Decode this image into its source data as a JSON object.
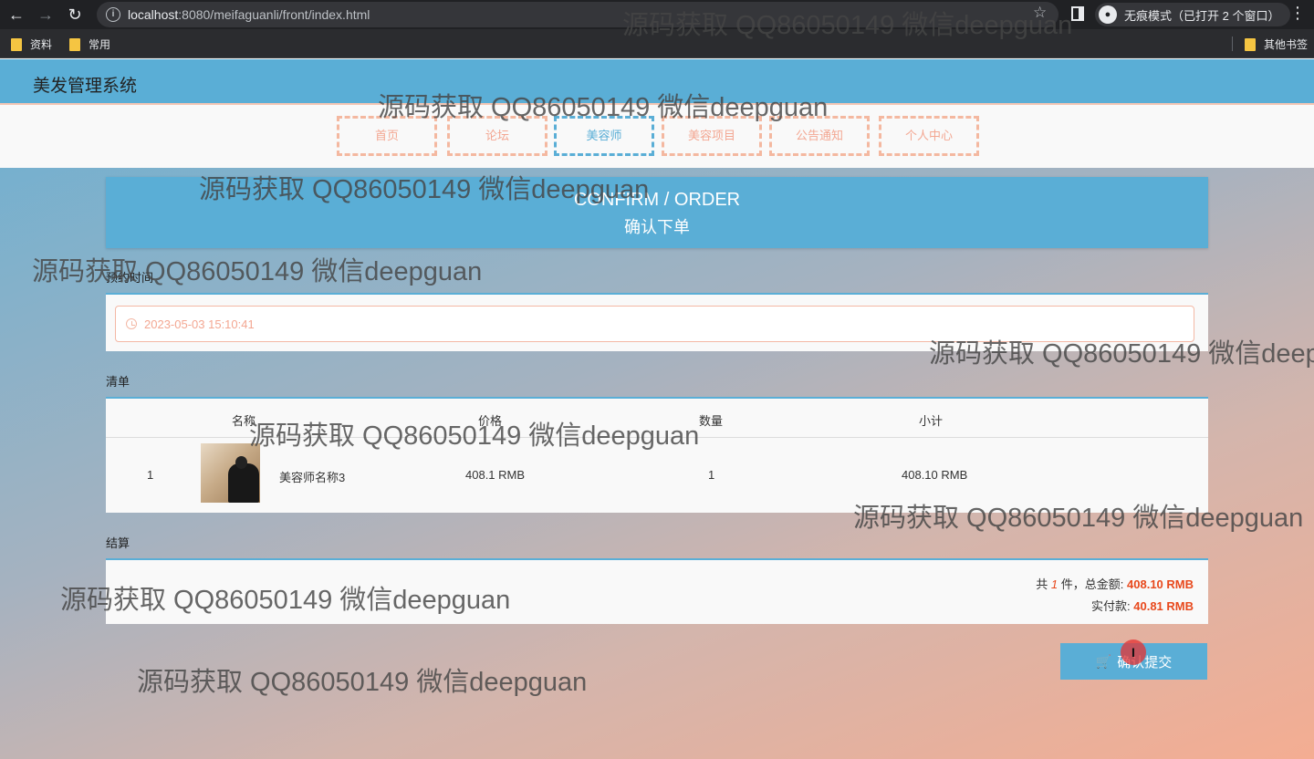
{
  "browser": {
    "url_host": "localhost",
    "url_rest": ":8080/meifaguanli/front/index.html",
    "incognito_label": "无痕模式（已打开 2 个窗口）",
    "bookmarks": [
      "资料",
      "常用"
    ],
    "other_bookmarks": "其他书签"
  },
  "site": {
    "title": "美发管理系统",
    "nav": [
      "首页",
      "论坛",
      "美容师",
      "美容项目",
      "公告通知",
      "个人中心"
    ],
    "active_nav": "美容师"
  },
  "banner": {
    "en": "CONFIRM / ORDER",
    "zh": "确认下单"
  },
  "booking": {
    "label": "预约时间",
    "value": "2023-05-03 15:10:41"
  },
  "list": {
    "label": "清单",
    "headers": [
      "名称",
      "价格",
      "数量",
      "小计"
    ],
    "rows": [
      {
        "index": "1",
        "name": "美容师名称3",
        "price": "408.1 RMB",
        "qty": "1",
        "subtotal": "408.10 RMB"
      }
    ]
  },
  "settlement": {
    "label": "结算",
    "count_prefix": "共",
    "count": "1",
    "count_suffix": "件，总金额:",
    "total": "408.10 RMB",
    "paid_label": "实付款:",
    "paid": "40.81 RMB"
  },
  "submit_label": "确认提交",
  "watermark_text": "源码获取 QQ86050149 微信deepguan",
  "colors": {
    "accent": "#5aaed6",
    "nav_border": "#f4b8a0",
    "price_red": "#e8491d"
  }
}
